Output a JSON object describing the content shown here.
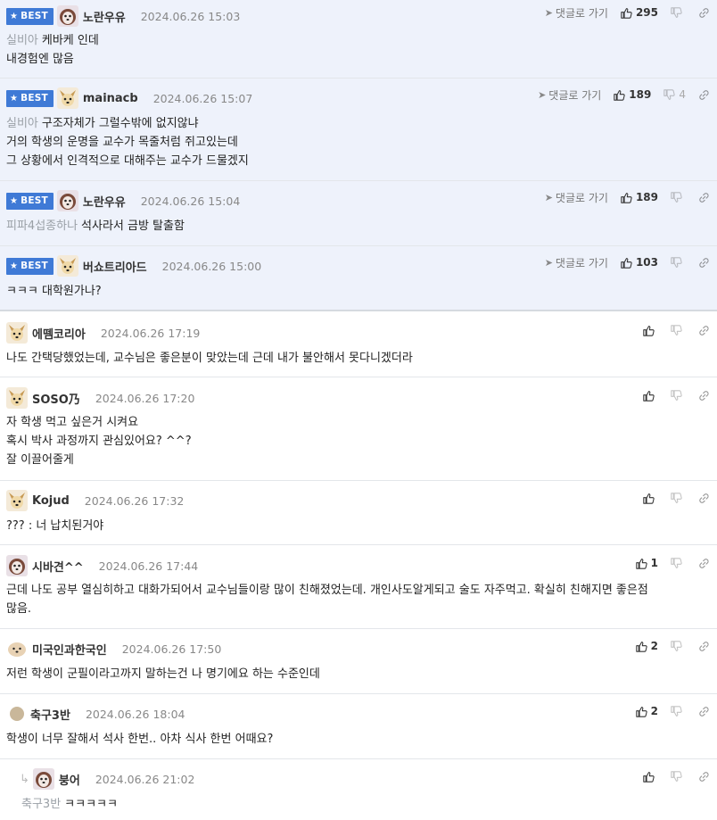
{
  "ui": {
    "best_label": "BEST",
    "goto_label": "댓글로 가기"
  },
  "best": [
    {
      "nick": "노란우유",
      "date": "2024.06.26 15:03",
      "likes": "295",
      "dislikes": "",
      "mention": "실비아",
      "lines": [
        "케바케 인데",
        "내경험엔 많음"
      ]
    },
    {
      "nick": "mainacb",
      "date": "2024.06.26 15:07",
      "likes": "189",
      "dislikes": "4",
      "mention": "실비아",
      "lines": [
        "구조자체가 그럴수밖에 없지않냐",
        "거의 학생의 운명을 교수가 목줄처럼 쥐고있는데",
        "그 상황에서 인격적으로 대해주는 교수가 드물겠지"
      ]
    },
    {
      "nick": "노란우유",
      "date": "2024.06.26 15:04",
      "likes": "189",
      "dislikes": "",
      "mention": "피파4섭종하나",
      "lines": [
        "석사라서 금방 탈출함"
      ]
    },
    {
      "nick": "버쇼트리아드",
      "date": "2024.06.26 15:00",
      "likes": "103",
      "dislikes": "",
      "mention": "",
      "lines": [
        "ㅋㅋㅋ 대학원가나?"
      ]
    }
  ],
  "comments": [
    {
      "nick": "에뗌코리아",
      "date": "2024.06.26 17:19",
      "likes": "",
      "mention": "",
      "lines": [
        "나도 간택당했었는데, 교수님은 좋은분이 맞았는데 근데 내가 불안해서 못다니겠더라"
      ]
    },
    {
      "nick": "SOSO乃",
      "date": "2024.06.26 17:20",
      "likes": "",
      "mention": "",
      "lines": [
        "자 학생 먹고 싶은거 시켜요",
        "혹시 박사 과정까지 관심있어요? ^^?",
        "잘 이끌어줄게"
      ]
    },
    {
      "nick": "Kojud",
      "date": "2024.06.26 17:32",
      "likes": "",
      "mention": "",
      "lines": [
        "??? : 너 납치된거야"
      ]
    },
    {
      "nick": "시바견^^",
      "date": "2024.06.26 17:44",
      "likes": "1",
      "mention": "",
      "lines": [
        "근데 나도 공부 열심히하고 대화가되어서 교수님들이랑 많이 친해졌었는데. 개인사도알게되고 술도 자주먹고. 확실히 친해지면 좋은점",
        "많음."
      ]
    },
    {
      "nick": "미국인과한국인",
      "date": "2024.06.26 17:50",
      "likes": "2",
      "mention": "",
      "lines": [
        "저런 학생이 군필이라고까지 말하는건 나 명기에요 하는 수준인데"
      ]
    },
    {
      "nick": "축구3반",
      "date": "2024.06.26 18:04",
      "likes": "2",
      "mention": "",
      "lines": [
        "학생이 너무 잘해서 석사 한번.. 아차 식사 한번 어때요?"
      ]
    },
    {
      "nick": "붕어",
      "date": "2024.06.26 21:02",
      "likes": "",
      "mention": "축구3반",
      "lines": [
        "ㅋㅋㅋㅋㅋ"
      ]
    }
  ],
  "icons": {
    "thumb_up": "thumb-up-icon",
    "thumb_down": "thumb-down-icon",
    "link": "link-icon",
    "arrow": "arrow-icon",
    "reply": "reply-arrow-icon",
    "star": "star-icon"
  },
  "colors": {
    "best_bg": "#eef2fb",
    "badge": "#3f7ad6",
    "mention": "#9aa0a6"
  }
}
